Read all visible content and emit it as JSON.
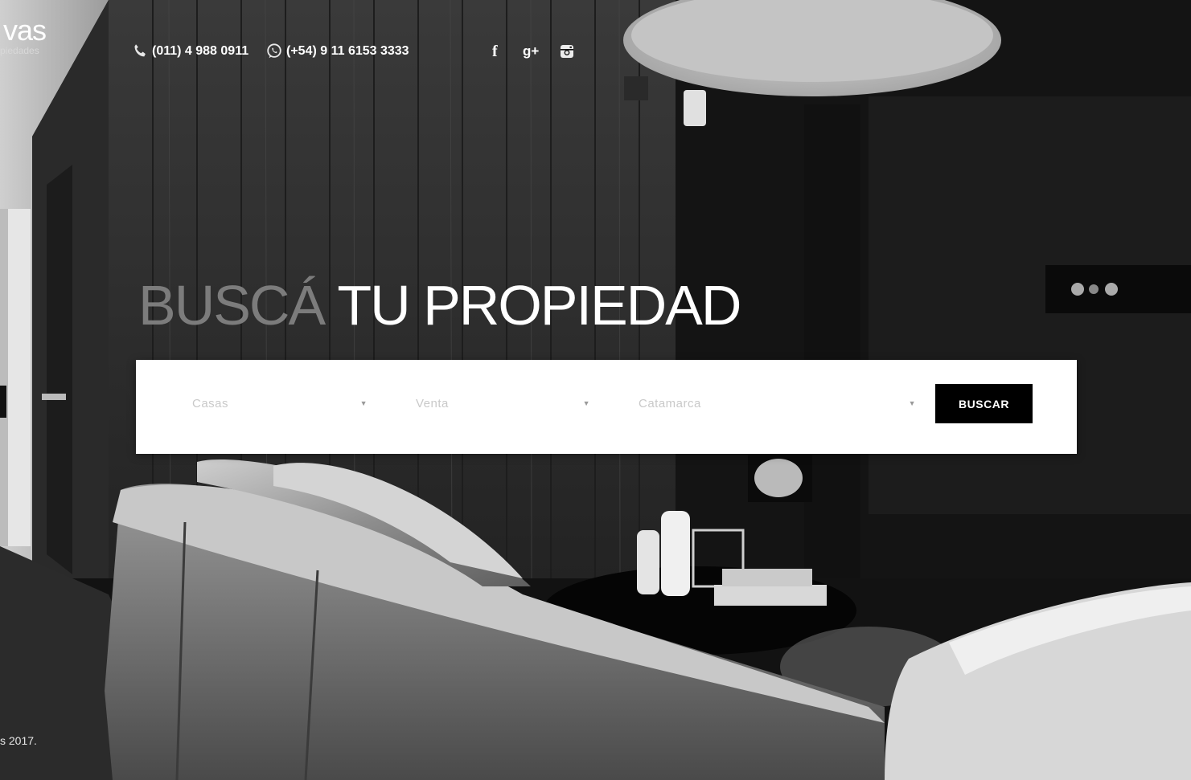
{
  "brand": {
    "name_fragment": "vas",
    "tagline_fragment": "piedades"
  },
  "contact": {
    "phone": "(011) 4 988 0911",
    "whatsapp": "(+54) 9 11 6153 3333",
    "phone_icon": "phone-icon",
    "whatsapp_icon": "whatsapp-icon"
  },
  "social": [
    {
      "name": "facebook",
      "glyph": "f",
      "icon": "facebook-icon"
    },
    {
      "name": "google-plus",
      "glyph": "g+",
      "icon": "google-plus-icon"
    },
    {
      "name": "instagram",
      "icon": "instagram-icon"
    }
  ],
  "hero": {
    "title_dim": "BUSCÁ",
    "title_bright": "TU PROPIEDAD"
  },
  "search": {
    "property_type": "Casas",
    "operation": "Venta",
    "location": "Catamarca",
    "button": "BUSCAR",
    "arrow_glyph": "▼"
  },
  "footer": {
    "copyright_fragment": "s 2017."
  },
  "colors": {
    "button_bg": "#000000",
    "box_bg": "#ffffff",
    "dim_title": "#7c7c7c"
  }
}
